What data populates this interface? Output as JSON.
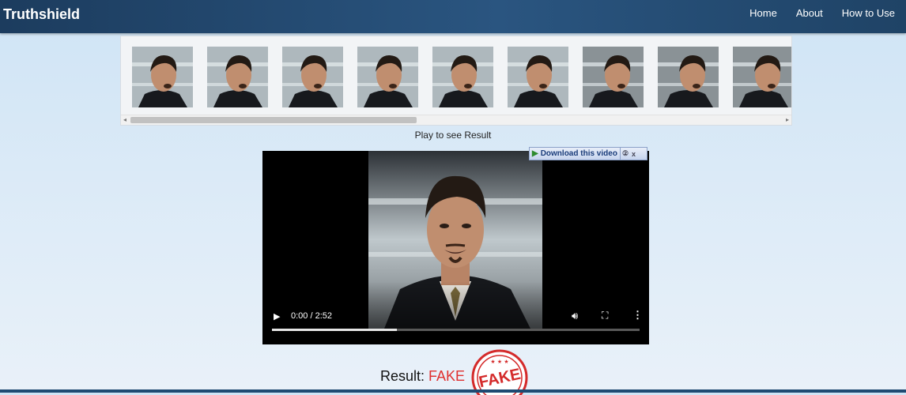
{
  "header": {
    "brand": "Truthshield",
    "nav": [
      "Home",
      "About",
      "How to Use"
    ]
  },
  "frames": {
    "count_visible": 9,
    "thumbnail_label": "video frame thumbnail"
  },
  "caption": "Play to see Result",
  "video": {
    "time": "0:00 / 2:52",
    "progress": 0.34
  },
  "download_bar": {
    "label": "Download this video",
    "help": "?",
    "close": "x"
  },
  "result": {
    "label": "Result:",
    "value": "FAKE",
    "stamp_text": "FAKE",
    "stamp_stars": "★ ★ ★"
  },
  "colors": {
    "header": "#1f4366",
    "fake": "#e03030",
    "background": "#dbeaf7"
  }
}
